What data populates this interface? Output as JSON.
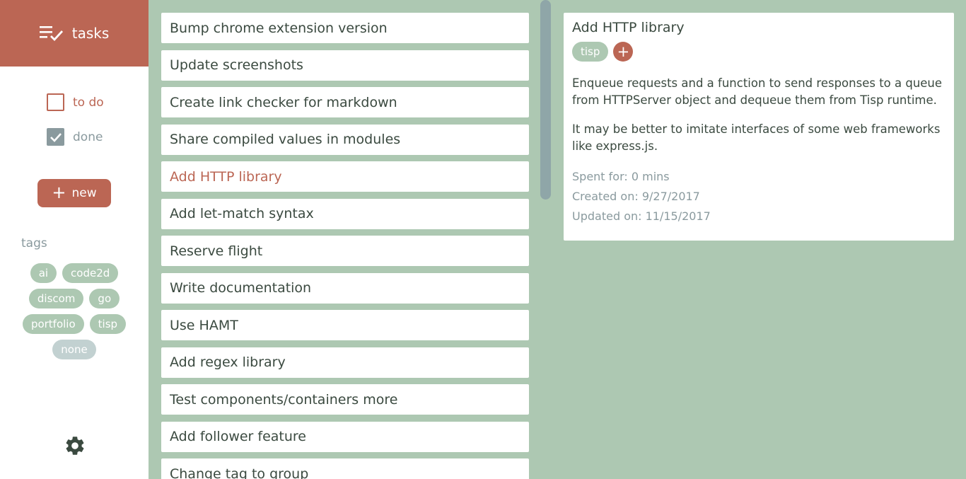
{
  "app": {
    "title": "tasks"
  },
  "filters": {
    "todo_label": "to do",
    "done_label": "done"
  },
  "new_button": {
    "label": "new"
  },
  "tags": {
    "title": "tags",
    "items": [
      "ai",
      "code2d",
      "discom",
      "go",
      "portfolio",
      "tisp",
      "none"
    ]
  },
  "tasks": [
    "Bump chrome extension version",
    "Update screenshots",
    "Create link checker for markdown",
    "Share compiled values in modules",
    "Add HTTP library",
    "Add let-match syntax",
    "Reserve flight",
    "Write documentation",
    "Use HAMT",
    "Add regex library",
    "Test components/containers more",
    "Add follower feature",
    "Change tag to group"
  ],
  "selected_task_index": 4,
  "detail": {
    "title": "Add HTTP library",
    "tags": [
      "tisp"
    ],
    "description": [
      "Enqueue requests and a function to send responses to a queue from HTTPServer object and dequeue them from Tisp runtime.",
      "It may be better to imitate interfaces of some web frameworks like express.js."
    ],
    "spent": "Spent for: 0 mins",
    "created": "Created on: 9/27/2017",
    "updated": "Updated on: 11/15/2017"
  },
  "icons": {
    "brand": "checklist-icon",
    "settings": "gear-icon"
  },
  "colors": {
    "accent": "#bb6654",
    "background": "#adc8b2",
    "muted": "#8a9a9e"
  }
}
